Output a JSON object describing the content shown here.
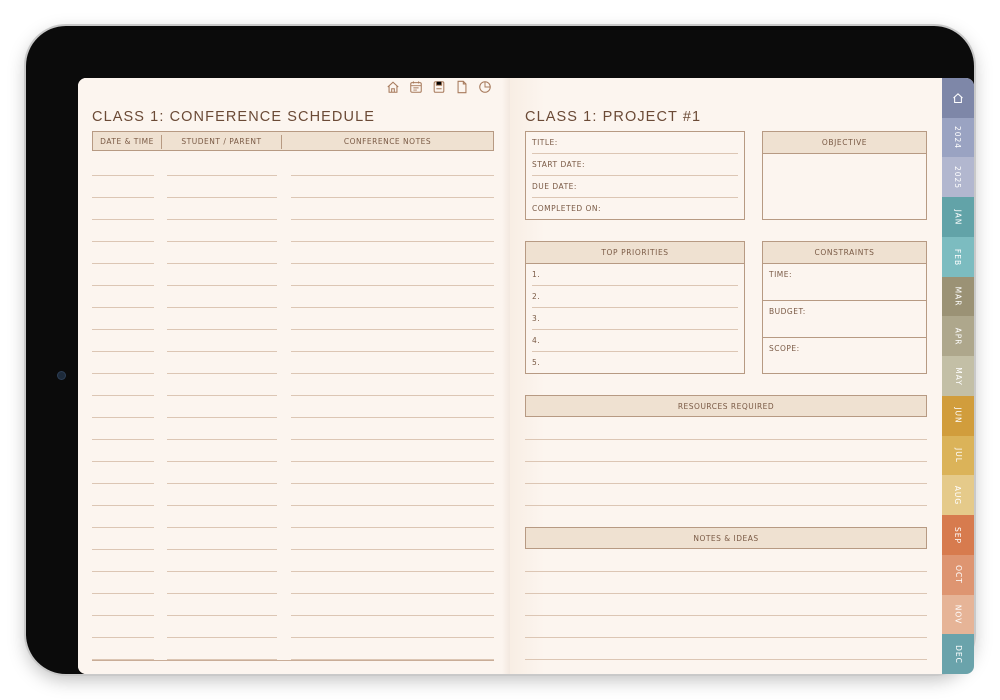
{
  "left": {
    "title": "CLASS 1: CONFERENCE SCHEDULE",
    "columns": [
      "DATE & TIME",
      "STUDENT / PARENT",
      "CONFERENCE NOTES"
    ]
  },
  "right": {
    "title": "CLASS 1: PROJECT #1",
    "project_fields": [
      "TITLE:",
      "START DATE:",
      "DUE DATE:",
      "COMPLETED ON:"
    ],
    "objective_label": "OBJECTIVE",
    "priorities_label": "TOP PRIORITIES",
    "priorities": [
      "1.",
      "2.",
      "3.",
      "4.",
      "5."
    ],
    "constraints_label": "CONSTRAINTS",
    "constraints": [
      "TIME:",
      "BUDGET:",
      "SCOPE:"
    ],
    "resources_label": "RESOURCES REQUIRED",
    "notes_label": "NOTES & IDEAS"
  },
  "nav_icons": [
    "home-icon",
    "calendar-icon",
    "save-icon",
    "page-icon",
    "clock-icon"
  ],
  "tabs": [
    {
      "label": "",
      "icon": "home-icon",
      "color": "#7e87a8"
    },
    {
      "label": "2024",
      "color": "#9aa3c2"
    },
    {
      "label": "2025",
      "color": "#b2b7cf"
    },
    {
      "label": "JAN",
      "color": "#62a3a8"
    },
    {
      "label": "FEB",
      "color": "#7cbcc0"
    },
    {
      "label": "MAR",
      "color": "#9b9275"
    },
    {
      "label": "APR",
      "color": "#aea78c"
    },
    {
      "label": "MAY",
      "color": "#c3bfa6"
    },
    {
      "label": "JUN",
      "color": "#d19d3c"
    },
    {
      "label": "JUL",
      "color": "#dbb359"
    },
    {
      "label": "AUG",
      "color": "#e5ca8a"
    },
    {
      "label": "SEP",
      "color": "#d77b4e"
    },
    {
      "label": "OCT",
      "color": "#de9571"
    },
    {
      "label": "NOV",
      "color": "#e6b497"
    },
    {
      "label": "DEC",
      "color": "#6aa3ab"
    }
  ],
  "colors": {
    "accent": "#6b4a36",
    "header_fill": "#efe1d1",
    "border": "#b79a83",
    "page": "#fcf5ef"
  }
}
